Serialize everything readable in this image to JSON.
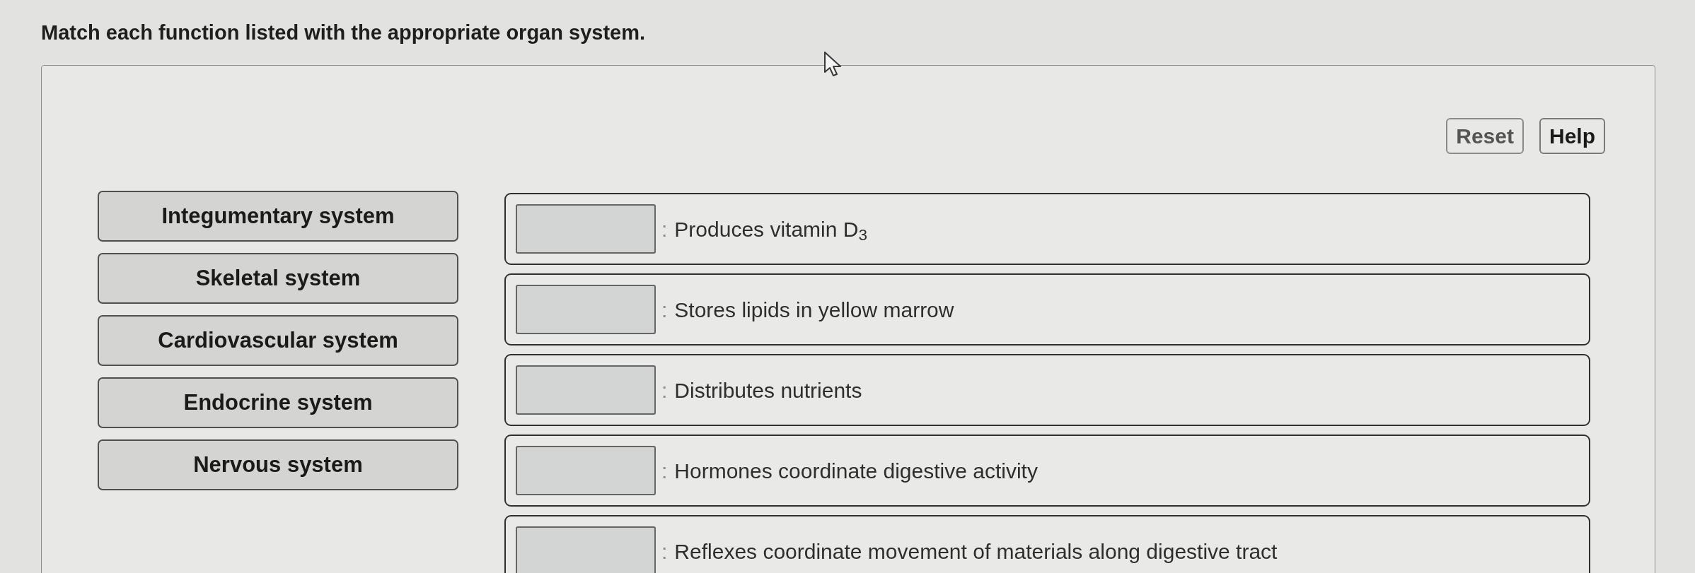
{
  "prompt": "Match each function listed with the appropriate organ system.",
  "buttons": [
    {
      "label": "Reset",
      "disabled": true
    },
    {
      "label": "Help",
      "disabled": false
    }
  ],
  "systems": [
    {
      "label": "Integumentary system"
    },
    {
      "label": "Skeletal system"
    },
    {
      "label": "Cardiovascular system"
    },
    {
      "label": "Endocrine system"
    },
    {
      "label": "Nervous system"
    }
  ],
  "functions": [
    {
      "separator": ":",
      "text": "Produces vitamin D$_{3}$"
    },
    {
      "separator": ":",
      "text": "Stores lipids in yellow marrow"
    },
    {
      "separator": ":",
      "text": "Distributes nutrients"
    },
    {
      "separator": ":",
      "text": "Hormones coordinate digestive activity"
    },
    {
      "separator": ":",
      "text": "Reflexes coordinate movement of materials along digestive tract"
    }
  ]
}
